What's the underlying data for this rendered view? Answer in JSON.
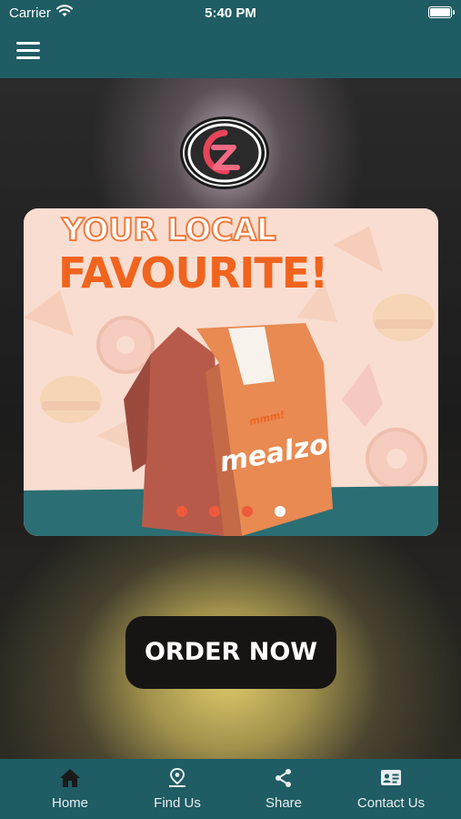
{
  "status_bar": {
    "carrier": "Carrier",
    "time": "5:40 PM"
  },
  "nav": {
    "menu_icon": "hamburger-menu-icon"
  },
  "logo": {
    "text": "CZ"
  },
  "banner": {
    "headline_line1": "YOUR LOCAL",
    "headline_line2": "FAVOURITE!",
    "bag_brand": "mealzo",
    "bag_tag": "mmm!",
    "slide_count": 4,
    "active_slide": 4
  },
  "order_button": {
    "label": "ORDER NOW"
  },
  "tabs": [
    {
      "label": "Home",
      "icon": "home-icon",
      "active": true
    },
    {
      "label": "Find Us",
      "icon": "location-pin-icon",
      "active": false
    },
    {
      "label": "Share",
      "icon": "share-icon",
      "active": false
    },
    {
      "label": "Contact Us",
      "icon": "contact-card-icon",
      "active": false
    }
  ],
  "colors": {
    "nav": "#1f5c63",
    "accent": "#f0641e",
    "button": "#171514"
  }
}
